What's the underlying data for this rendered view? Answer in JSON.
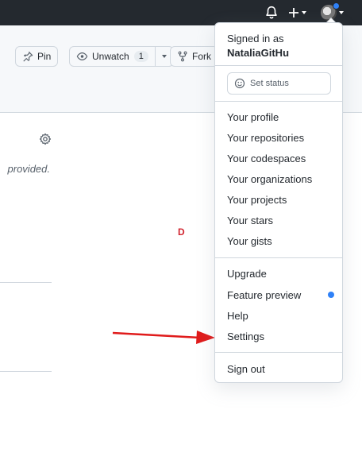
{
  "header": {
    "icons": [
      "bell-icon",
      "plus-icon",
      "avatar"
    ],
    "notification_color": "#2f81f7"
  },
  "repo_actions": {
    "pin_label": "Pin",
    "unwatch_label": "Unwatch",
    "watch_count": "1",
    "fork_label": "Fork"
  },
  "content": {
    "description_fragment": "provided.",
    "annotation_letter": "D",
    "annotation_color": "#d1242f"
  },
  "user_menu": {
    "signed_in_label": "Signed in as",
    "username": "NataliaGitHu",
    "set_status_label": "Set status",
    "section1": [
      "Your profile",
      "Your repositories",
      "Your codespaces",
      "Your organizations",
      "Your projects",
      "Your stars",
      "Your gists"
    ],
    "section2": [
      "Upgrade",
      "Feature preview",
      "Help",
      "Settings"
    ],
    "sign_out_label": "Sign out"
  }
}
